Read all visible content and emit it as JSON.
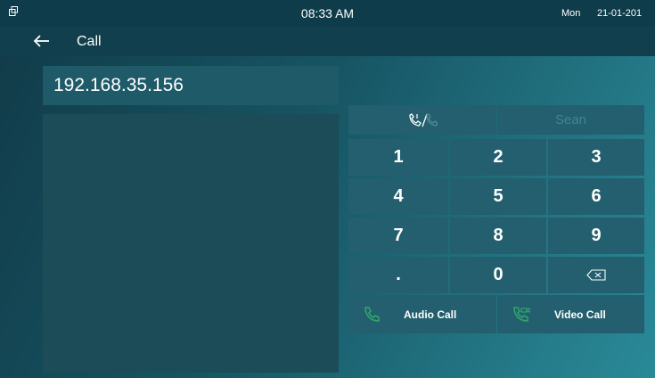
{
  "status_bar": {
    "time": "08:33 AM",
    "day": "Mon",
    "date": "21-01-201",
    "window_icon": "window-restore-icon"
  },
  "header": {
    "title": "Call",
    "back_icon": "arrow-left-icon"
  },
  "dial": {
    "address": "192.168.35.156"
  },
  "mode_row": {
    "toggle_icon": "call-mode-toggle-icon",
    "contact": "Sean"
  },
  "keypad": {
    "keys": [
      "1",
      "2",
      "3",
      "4",
      "5",
      "6",
      "7",
      "8",
      "9",
      ".",
      "0"
    ],
    "backspace_icon": "backspace-icon"
  },
  "actions": {
    "audio_call": "Audio Call",
    "video_call": "Video Call",
    "audio_icon": "phone-icon",
    "video_icon": "video-phone-icon"
  },
  "colors": {
    "accent": "#2fa56b"
  }
}
